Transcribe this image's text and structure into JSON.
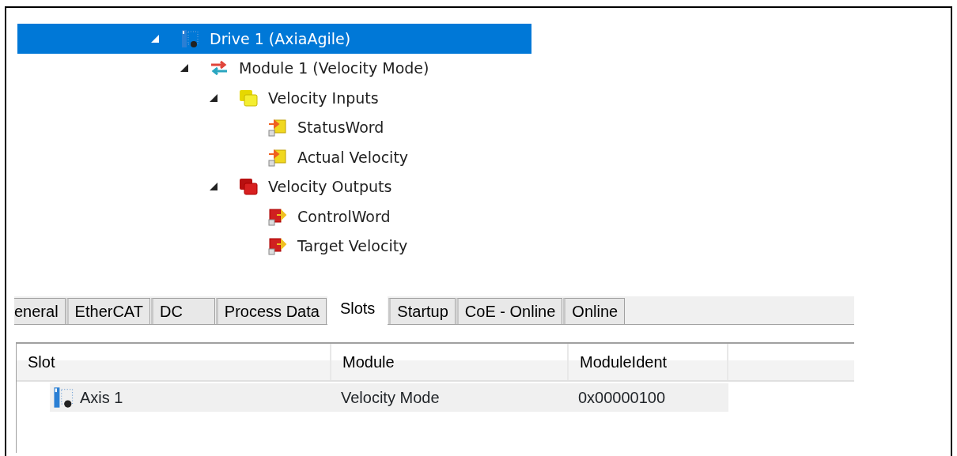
{
  "tree": [
    {
      "label": "Drive 1 (AxiaAgile)",
      "kind": "device",
      "selected": true,
      "expanded": true,
      "children": [
        {
          "label": "Module 1 (Velocity Mode)",
          "kind": "module",
          "selected": false,
          "expanded": true,
          "children": [
            {
              "label": "Velocity Inputs",
              "kind": "inputs",
              "selected": false,
              "expanded": true,
              "children": [
                {
                  "label": "StatusWord",
                  "kind": "input-var",
                  "selected": false
                },
                {
                  "label": "Actual Velocity",
                  "kind": "input-var",
                  "selected": false
                }
              ]
            },
            {
              "label": "Velocity Outputs",
              "kind": "outputs",
              "selected": false,
              "expanded": true,
              "children": [
                {
                  "label": "ControlWord",
                  "kind": "output-var",
                  "selected": false
                },
                {
                  "label": "Target Velocity",
                  "kind": "output-var",
                  "selected": false
                }
              ]
            }
          ]
        }
      ]
    }
  ],
  "tabs": [
    {
      "label": "eneral",
      "selected": false
    },
    {
      "label": "EtherCAT",
      "selected": false
    },
    {
      "label": "DC",
      "selected": false
    },
    {
      "label": "Process Data",
      "selected": false
    },
    {
      "label": "Slots",
      "selected": true
    },
    {
      "label": "Startup",
      "selected": false
    },
    {
      "label": "CoE - Online",
      "selected": false
    },
    {
      "label": "Online",
      "selected": false
    }
  ],
  "table": {
    "columns": [
      "Slot",
      "Module",
      "ModuleIdent"
    ],
    "rows": [
      {
        "slot": "Axis 1",
        "kind": "device",
        "module": "Velocity Mode",
        "module_ident": "0x00000100"
      }
    ]
  }
}
